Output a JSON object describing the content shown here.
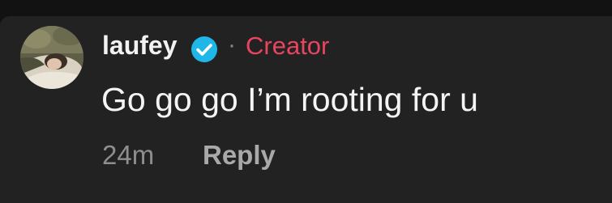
{
  "comment": {
    "author": "laufey",
    "separator": "·",
    "author_badge": "Creator",
    "text": "Go go go I’m rooting for u",
    "time": "24m",
    "reply_label": "Reply",
    "verified_icon": "verified-check-icon",
    "colors": {
      "background": "#222222",
      "outer_background": "#121212",
      "author": "#f2f2f2",
      "creator_badge": "#e8455e",
      "verified": "#1fb6e8",
      "time": "#8e8e8e",
      "reply": "#a9a9a9"
    }
  }
}
